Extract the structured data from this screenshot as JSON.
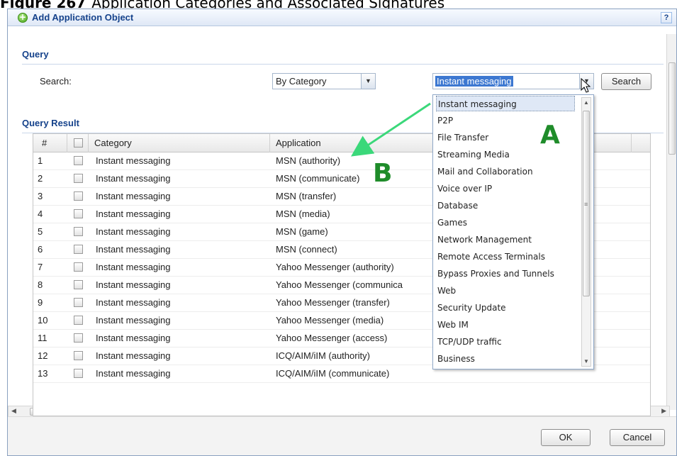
{
  "caption": {
    "figure": "Figure 267",
    "text": "Application Categories and Associated Signatures"
  },
  "dialog": {
    "title": "Add Application Object",
    "help_label": "?"
  },
  "query": {
    "label": "Query",
    "search_label": "Search:",
    "search_by": "By Category",
    "category_value": "Instant messaging",
    "search_button": "Search"
  },
  "result": {
    "label": "Query Result",
    "columns": {
      "num": "#",
      "category": "Category",
      "application": "Application"
    },
    "rows": [
      {
        "num": "1",
        "category": "Instant messaging",
        "application": "MSN (authority)"
      },
      {
        "num": "2",
        "category": "Instant messaging",
        "application": "MSN (communicate)"
      },
      {
        "num": "3",
        "category": "Instant messaging",
        "application": "MSN (transfer)"
      },
      {
        "num": "4",
        "category": "Instant messaging",
        "application": "MSN (media)"
      },
      {
        "num": "5",
        "category": "Instant messaging",
        "application": "MSN (game)"
      },
      {
        "num": "6",
        "category": "Instant messaging",
        "application": "MSN (connect)"
      },
      {
        "num": "7",
        "category": "Instant messaging",
        "application": "Yahoo Messenger (authority)"
      },
      {
        "num": "8",
        "category": "Instant messaging",
        "application": "Yahoo Messenger (communica"
      },
      {
        "num": "9",
        "category": "Instant messaging",
        "application": "Yahoo Messenger (transfer)"
      },
      {
        "num": "10",
        "category": "Instant messaging",
        "application": "Yahoo Messenger (media)"
      },
      {
        "num": "11",
        "category": "Instant messaging",
        "application": "Yahoo Messenger (access)"
      },
      {
        "num": "12",
        "category": "Instant messaging",
        "application": "ICQ/AIM/iIM (authority)"
      },
      {
        "num": "13",
        "category": "Instant messaging",
        "application": "ICQ/AIM/iIM (communicate)"
      }
    ]
  },
  "dropdown": {
    "options": [
      "Instant messaging",
      "P2P",
      "File Transfer",
      "Streaming Media",
      "Mail and Collaboration",
      "Voice over IP",
      "Database",
      "Games",
      "Network Management",
      "Remote Access Terminals",
      "Bypass Proxies and Tunnels",
      "Web",
      "Security Update",
      "Web IM",
      "TCP/UDP traffic",
      "Business"
    ],
    "selected": "Instant messaging"
  },
  "callouts": {
    "a": "A",
    "b": "B"
  },
  "footer": {
    "ok": "OK",
    "cancel": "Cancel"
  },
  "colors": {
    "title_blue": "#15428b",
    "callout_green": "#1f8c2a",
    "arrow_green": "#3bd87a",
    "highlight": "#3d78d1"
  },
  "icons": {
    "title": "plus-circle-icon",
    "help": "help-icon",
    "combo": "chevron-down-icon",
    "cursor": "mouse-pointer-icon"
  }
}
